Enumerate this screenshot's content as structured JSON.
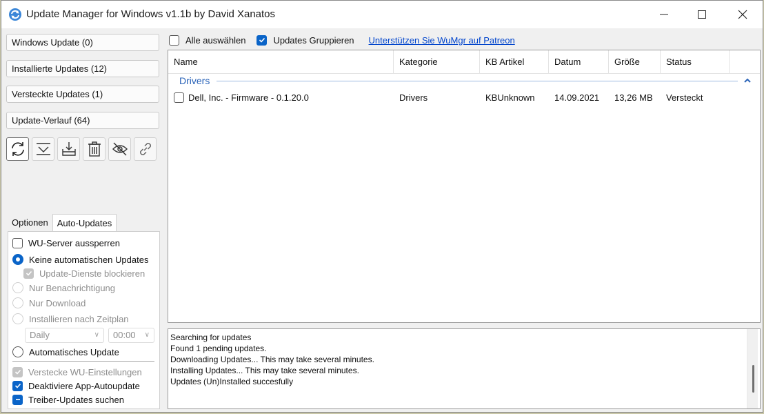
{
  "window": {
    "title": "Update Manager for Windows v1.1b by David Xanatos"
  },
  "left": {
    "nav": [
      {
        "label": "Windows Update (0)"
      },
      {
        "label": "Installierte Updates (12)"
      },
      {
        "label": "Versteckte Updates (1)"
      },
      {
        "label": "Update-Verlauf (64)"
      }
    ],
    "toolbar_icons": [
      "refresh-icon",
      "download-icon",
      "install-icon",
      "delete-icon",
      "hide-icon",
      "link-icon"
    ],
    "tabs": [
      {
        "label": "Optionen",
        "active": false
      },
      {
        "label": "Auto-Updates",
        "active": true
      }
    ],
    "options": {
      "block_wu_server": "WU-Server aussperren",
      "no_auto_updates": "Keine automatischen Updates",
      "block_update_services": "Update-Dienste blockieren",
      "notify_only": "Nur Benachrichtigung",
      "download_only": "Nur Download",
      "scheduled_install": "Installieren nach Zeitplan",
      "schedule_day": "Daily",
      "schedule_time": "00:00",
      "automatic_update": "Automatisches Update",
      "hide_wu_settings": "Verstecke WU-Einstellungen",
      "disable_app_autoupdate": "Deaktiviere App-Autoupdate",
      "search_driver_updates": "Treiber-Updates suchen"
    }
  },
  "right": {
    "select_all": "Alle auswählen",
    "group_updates": "Updates Gruppieren",
    "patreon_link": "Unterstützen Sie WuMgr auf Patreon",
    "columns": [
      "Name",
      "Kategorie",
      "KB Artikel",
      "Datum",
      "Größe",
      "Status"
    ],
    "group_name": "Drivers",
    "rows": [
      {
        "name": "Dell, Inc. - Firmware - 0.1.20.0",
        "category": "Drivers",
        "kb": "KBUnknown",
        "date": "14.09.2021",
        "size": "13,26 MB",
        "status": "Versteckt"
      }
    ],
    "log": [
      "Searching for updates",
      "Found 1 pending updates.",
      "Downloading Updates... This may take several minutes.",
      "Installing Updates... This may take several minutes.",
      "Updates (Un)Installed succesfully"
    ]
  },
  "colors": {
    "accent": "#0a64c8",
    "group_header": "#2a63b8",
    "link": "#0044cc"
  }
}
